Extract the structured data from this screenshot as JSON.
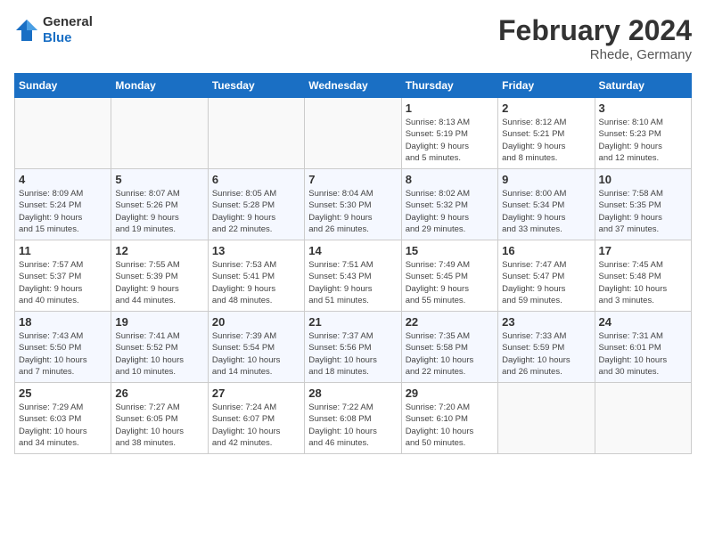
{
  "header": {
    "logo_general": "General",
    "logo_blue": "Blue",
    "month_title": "February 2024",
    "subtitle": "Rhede, Germany"
  },
  "weekdays": [
    "Sunday",
    "Monday",
    "Tuesday",
    "Wednesday",
    "Thursday",
    "Friday",
    "Saturday"
  ],
  "weeks": [
    [
      {
        "day": "",
        "info": ""
      },
      {
        "day": "",
        "info": ""
      },
      {
        "day": "",
        "info": ""
      },
      {
        "day": "",
        "info": ""
      },
      {
        "day": "1",
        "info": "Sunrise: 8:13 AM\nSunset: 5:19 PM\nDaylight: 9 hours\nand 5 minutes."
      },
      {
        "day": "2",
        "info": "Sunrise: 8:12 AM\nSunset: 5:21 PM\nDaylight: 9 hours\nand 8 minutes."
      },
      {
        "day": "3",
        "info": "Sunrise: 8:10 AM\nSunset: 5:23 PM\nDaylight: 9 hours\nand 12 minutes."
      }
    ],
    [
      {
        "day": "4",
        "info": "Sunrise: 8:09 AM\nSunset: 5:24 PM\nDaylight: 9 hours\nand 15 minutes."
      },
      {
        "day": "5",
        "info": "Sunrise: 8:07 AM\nSunset: 5:26 PM\nDaylight: 9 hours\nand 19 minutes."
      },
      {
        "day": "6",
        "info": "Sunrise: 8:05 AM\nSunset: 5:28 PM\nDaylight: 9 hours\nand 22 minutes."
      },
      {
        "day": "7",
        "info": "Sunrise: 8:04 AM\nSunset: 5:30 PM\nDaylight: 9 hours\nand 26 minutes."
      },
      {
        "day": "8",
        "info": "Sunrise: 8:02 AM\nSunset: 5:32 PM\nDaylight: 9 hours\nand 29 minutes."
      },
      {
        "day": "9",
        "info": "Sunrise: 8:00 AM\nSunset: 5:34 PM\nDaylight: 9 hours\nand 33 minutes."
      },
      {
        "day": "10",
        "info": "Sunrise: 7:58 AM\nSunset: 5:35 PM\nDaylight: 9 hours\nand 37 minutes."
      }
    ],
    [
      {
        "day": "11",
        "info": "Sunrise: 7:57 AM\nSunset: 5:37 PM\nDaylight: 9 hours\nand 40 minutes."
      },
      {
        "day": "12",
        "info": "Sunrise: 7:55 AM\nSunset: 5:39 PM\nDaylight: 9 hours\nand 44 minutes."
      },
      {
        "day": "13",
        "info": "Sunrise: 7:53 AM\nSunset: 5:41 PM\nDaylight: 9 hours\nand 48 minutes."
      },
      {
        "day": "14",
        "info": "Sunrise: 7:51 AM\nSunset: 5:43 PM\nDaylight: 9 hours\nand 51 minutes."
      },
      {
        "day": "15",
        "info": "Sunrise: 7:49 AM\nSunset: 5:45 PM\nDaylight: 9 hours\nand 55 minutes."
      },
      {
        "day": "16",
        "info": "Sunrise: 7:47 AM\nSunset: 5:47 PM\nDaylight: 9 hours\nand 59 minutes."
      },
      {
        "day": "17",
        "info": "Sunrise: 7:45 AM\nSunset: 5:48 PM\nDaylight: 10 hours\nand 3 minutes."
      }
    ],
    [
      {
        "day": "18",
        "info": "Sunrise: 7:43 AM\nSunset: 5:50 PM\nDaylight: 10 hours\nand 7 minutes."
      },
      {
        "day": "19",
        "info": "Sunrise: 7:41 AM\nSunset: 5:52 PM\nDaylight: 10 hours\nand 10 minutes."
      },
      {
        "day": "20",
        "info": "Sunrise: 7:39 AM\nSunset: 5:54 PM\nDaylight: 10 hours\nand 14 minutes."
      },
      {
        "day": "21",
        "info": "Sunrise: 7:37 AM\nSunset: 5:56 PM\nDaylight: 10 hours\nand 18 minutes."
      },
      {
        "day": "22",
        "info": "Sunrise: 7:35 AM\nSunset: 5:58 PM\nDaylight: 10 hours\nand 22 minutes."
      },
      {
        "day": "23",
        "info": "Sunrise: 7:33 AM\nSunset: 5:59 PM\nDaylight: 10 hours\nand 26 minutes."
      },
      {
        "day": "24",
        "info": "Sunrise: 7:31 AM\nSunset: 6:01 PM\nDaylight: 10 hours\nand 30 minutes."
      }
    ],
    [
      {
        "day": "25",
        "info": "Sunrise: 7:29 AM\nSunset: 6:03 PM\nDaylight: 10 hours\nand 34 minutes."
      },
      {
        "day": "26",
        "info": "Sunrise: 7:27 AM\nSunset: 6:05 PM\nDaylight: 10 hours\nand 38 minutes."
      },
      {
        "day": "27",
        "info": "Sunrise: 7:24 AM\nSunset: 6:07 PM\nDaylight: 10 hours\nand 42 minutes."
      },
      {
        "day": "28",
        "info": "Sunrise: 7:22 AM\nSunset: 6:08 PM\nDaylight: 10 hours\nand 46 minutes."
      },
      {
        "day": "29",
        "info": "Sunrise: 7:20 AM\nSunset: 6:10 PM\nDaylight: 10 hours\nand 50 minutes."
      },
      {
        "day": "",
        "info": ""
      },
      {
        "day": "",
        "info": ""
      }
    ]
  ]
}
